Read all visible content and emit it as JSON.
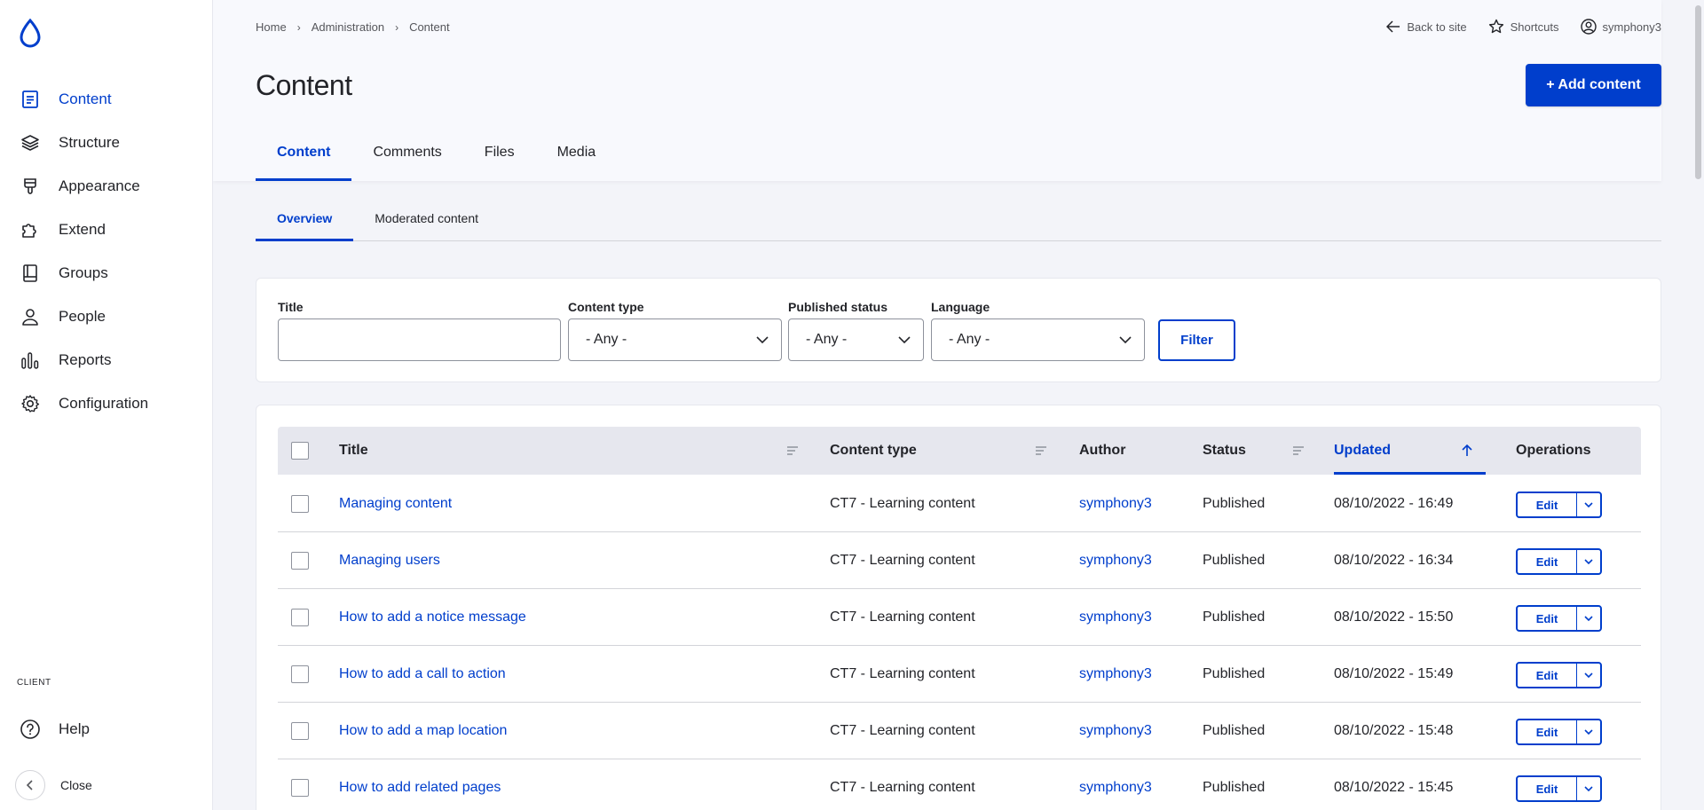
{
  "colors": {
    "accent": "#003ecc",
    "text": "#232429",
    "background": "#f3f4f9"
  },
  "sidebar": {
    "logo_icon": "drupal-drop-icon",
    "items": [
      {
        "label": "Content",
        "icon": "document-icon",
        "active": true
      },
      {
        "label": "Structure",
        "icon": "layers-icon"
      },
      {
        "label": "Appearance",
        "icon": "brush-icon"
      },
      {
        "label": "Extend",
        "icon": "puzzle-icon"
      },
      {
        "label": "Groups",
        "icon": "book-icon"
      },
      {
        "label": "People",
        "icon": "person-icon"
      },
      {
        "label": "Reports",
        "icon": "bar-chart-icon"
      },
      {
        "label": "Configuration",
        "icon": "gear-icon"
      }
    ],
    "section_label": "CLIENT",
    "help_label": "Help",
    "close_label": "Close"
  },
  "breadcrumb": [
    "Home",
    "Administration",
    "Content"
  ],
  "toolbar": {
    "back_label": "Back to site",
    "shortcuts_label": "Shortcuts",
    "user_label": "symphony3"
  },
  "page": {
    "title": "Content",
    "add_button": "+ Add content"
  },
  "primary_tabs": [
    "Content",
    "Comments",
    "Files",
    "Media"
  ],
  "secondary_tabs": [
    "Overview",
    "Moderated content"
  ],
  "filters": {
    "title_label": "Title",
    "title_value": "",
    "content_type_label": "Content type",
    "content_type_value": "- Any -",
    "published_label": "Published status",
    "published_value": "- Any -",
    "language_label": "Language",
    "language_value": "- Any -",
    "filter_button": "Filter"
  },
  "table": {
    "headers": {
      "title": "Title",
      "content_type": "Content type",
      "author": "Author",
      "status": "Status",
      "updated": "Updated",
      "operations": "Operations"
    },
    "edit_label": "Edit",
    "rows": [
      {
        "title": "Managing content",
        "type": "CT7 - Learning content",
        "author": "symphony3",
        "status": "Published",
        "updated": "08/10/2022 - 16:49"
      },
      {
        "title": "Managing users",
        "type": "CT7 - Learning content",
        "author": "symphony3",
        "status": "Published",
        "updated": "08/10/2022 - 16:34"
      },
      {
        "title": "How to add a notice message",
        "type": "CT7 - Learning content",
        "author": "symphony3",
        "status": "Published",
        "updated": "08/10/2022 - 15:50"
      },
      {
        "title": "How to add a call to action",
        "type": "CT7 - Learning content",
        "author": "symphony3",
        "status": "Published",
        "updated": "08/10/2022 - 15:49"
      },
      {
        "title": "How to add a map location",
        "type": "CT7 - Learning content",
        "author": "symphony3",
        "status": "Published",
        "updated": "08/10/2022 - 15:48"
      },
      {
        "title": "How to add related pages",
        "type": "CT7 - Learning content",
        "author": "symphony3",
        "status": "Published",
        "updated": "08/10/2022 - 15:45"
      }
    ]
  }
}
